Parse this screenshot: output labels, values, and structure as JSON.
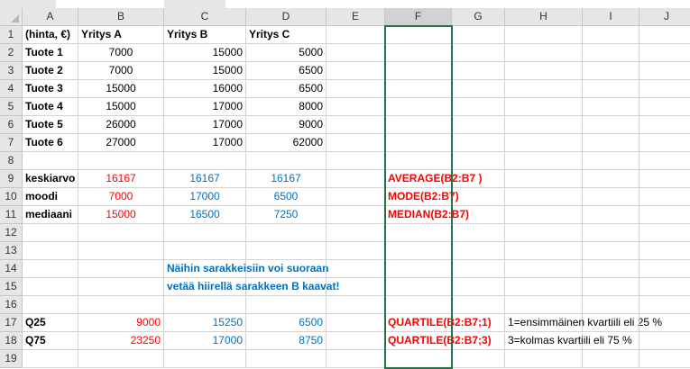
{
  "columns": [
    "A",
    "B",
    "C",
    "D",
    "E",
    "F",
    "G",
    "H",
    "I",
    "J"
  ],
  "rows": [
    {
      "n": "1",
      "cells": {
        "A": {
          "t": "(hinta, €)",
          "s": "bold"
        },
        "B": {
          "t": "Yritys A",
          "s": "bold"
        },
        "C": {
          "t": "Yritys B",
          "s": "bold"
        },
        "D": {
          "t": "Yritys C",
          "s": "bold"
        }
      }
    },
    {
      "n": "2",
      "cells": {
        "A": {
          "t": "Tuote 1",
          "s": "bold"
        },
        "B": {
          "t": "7000",
          "s": "center"
        },
        "C": {
          "t": "15000",
          "s": "right"
        },
        "D": {
          "t": "5000",
          "s": "right"
        }
      }
    },
    {
      "n": "3",
      "cells": {
        "A": {
          "t": "Tuote 2",
          "s": "bold"
        },
        "B": {
          "t": "7000",
          "s": "center"
        },
        "C": {
          "t": "15000",
          "s": "right"
        },
        "D": {
          "t": "6500",
          "s": "right"
        }
      }
    },
    {
      "n": "4",
      "cells": {
        "A": {
          "t": "Tuote 3",
          "s": "bold"
        },
        "B": {
          "t": "15000",
          "s": "center"
        },
        "C": {
          "t": "16000",
          "s": "right"
        },
        "D": {
          "t": "6500",
          "s": "right"
        }
      }
    },
    {
      "n": "5",
      "cells": {
        "A": {
          "t": "Tuote 4",
          "s": "bold"
        },
        "B": {
          "t": "15000",
          "s": "center"
        },
        "C": {
          "t": "17000",
          "s": "right"
        },
        "D": {
          "t": "8000",
          "s": "right"
        }
      }
    },
    {
      "n": "6",
      "cells": {
        "A": {
          "t": "Tuote 5",
          "s": "bold"
        },
        "B": {
          "t": "26000",
          "s": "center"
        },
        "C": {
          "t": "17000",
          "s": "right"
        },
        "D": {
          "t": "9000",
          "s": "right"
        }
      }
    },
    {
      "n": "7",
      "cells": {
        "A": {
          "t": "Tuote 6",
          "s": "bold"
        },
        "B": {
          "t": "27000",
          "s": "center"
        },
        "C": {
          "t": "17000",
          "s": "right"
        },
        "D": {
          "t": "62000",
          "s": "right"
        }
      }
    },
    {
      "n": "8",
      "cells": {}
    },
    {
      "n": "9",
      "cells": {
        "A": {
          "t": "keskiarvo",
          "s": "bold"
        },
        "B": {
          "t": "16167",
          "s": "center red"
        },
        "C": {
          "t": "16167",
          "s": "center blue"
        },
        "D": {
          "t": "16167",
          "s": "center blue"
        },
        "F": {
          "t": "AVERAGE(B2:B7 )",
          "s": "bold red"
        }
      }
    },
    {
      "n": "10",
      "cells": {
        "A": {
          "t": "moodi",
          "s": "bold"
        },
        "B": {
          "t": "7000",
          "s": "center red"
        },
        "C": {
          "t": "17000",
          "s": "center blue"
        },
        "D": {
          "t": "6500",
          "s": "center blue"
        },
        "F": {
          "t": "MODE(B2:B7)",
          "s": "bold red"
        }
      }
    },
    {
      "n": "11",
      "cells": {
        "A": {
          "t": "mediaani",
          "s": "bold"
        },
        "B": {
          "t": "15000",
          "s": "center red"
        },
        "C": {
          "t": "16500",
          "s": "center blue"
        },
        "D": {
          "t": "7250",
          "s": "center blue"
        },
        "F": {
          "t": "MEDIAN(B2:B7)",
          "s": "bold red"
        }
      }
    },
    {
      "n": "12",
      "cells": {}
    },
    {
      "n": "13",
      "cells": {}
    },
    {
      "n": "14",
      "cells": {
        "C": {
          "t": "Näihin sarakkeisiin voi suoraan",
          "s": "bold blue"
        }
      }
    },
    {
      "n": "15",
      "cells": {
        "C": {
          "t": "vetää hiirellä sarakkeen B kaavat!",
          "s": "bold blue"
        }
      }
    },
    {
      "n": "16",
      "cells": {}
    },
    {
      "n": "17",
      "cells": {
        "A": {
          "t": "Q25",
          "s": "bold"
        },
        "B": {
          "t": "9000",
          "s": "right red"
        },
        "C": {
          "t": "15250",
          "s": "right blue"
        },
        "D": {
          "t": "6500",
          "s": "right blue"
        },
        "F": {
          "t": "QUARTILE(B2:B7;1)",
          "s": "bold red"
        },
        "H": {
          "t": "1=ensimmäinen kvartiili eli 25 %",
          "s": ""
        }
      }
    },
    {
      "n": "18",
      "cells": {
        "A": {
          "t": "Q75",
          "s": "bold"
        },
        "B": {
          "t": "23250",
          "s": "right red"
        },
        "C": {
          "t": "17000",
          "s": "right blue"
        },
        "D": {
          "t": "8750",
          "s": "right blue"
        },
        "F": {
          "t": "QUARTILE(B2:B7;3)",
          "s": "bold red"
        },
        "H": {
          "t": "3=kolmas kvartiili eli 75 %",
          "s": ""
        }
      }
    },
    {
      "n": "19",
      "cells": {}
    }
  ],
  "selected_column": "F",
  "colors": {
    "red": "#ff0000",
    "blue": "#0070c0",
    "header_bg": "#e6e6e6",
    "selection": "#217346"
  }
}
